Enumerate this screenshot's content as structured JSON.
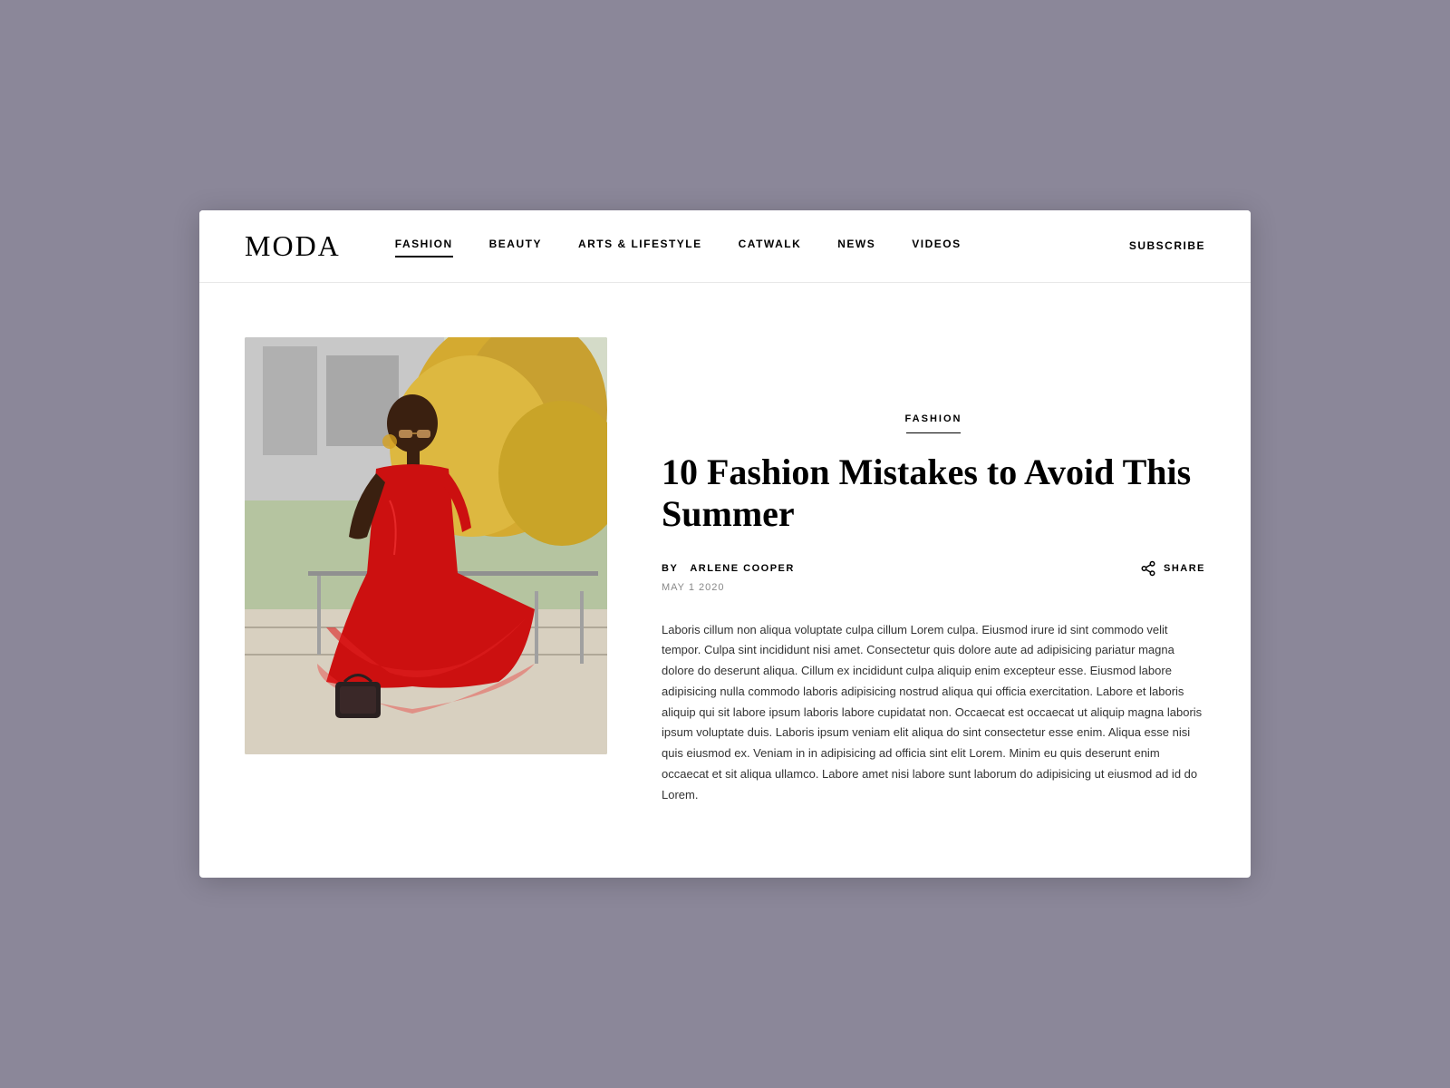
{
  "site": {
    "logo": "MODA",
    "nav": {
      "items": [
        {
          "label": "FASHION",
          "active": true
        },
        {
          "label": "BEAUTY",
          "active": false
        },
        {
          "label": "ARTS & LIFESTYLE",
          "active": false
        },
        {
          "label": "CATWALK",
          "active": false
        },
        {
          "label": "NEWS",
          "active": false
        },
        {
          "label": "VIDEOS",
          "active": false
        }
      ],
      "subscribe_label": "SUBSCRIBE"
    }
  },
  "article": {
    "category": "FASHION",
    "title": "10 Fashion Mistakes to Avoid This Summer",
    "author_prefix": "BY",
    "author": "ARLENE COOPER",
    "date": "MAY 1 2020",
    "share_label": "SHARE",
    "body": "Laboris cillum non aliqua voluptate culpa cillum Lorem culpa. Eiusmod irure id sint commodo velit tempor. Culpa sint incididunt nisi amet. Consectetur quis dolore aute ad adipisicing pariatur magna dolore do deserunt aliqua. Cillum ex incididunt culpa aliquip enim excepteur esse. Eiusmod labore adipisicing nulla commodo laboris adipisicing nostrud aliqua qui officia exercitation. Labore et laboris aliquip qui sit labore ipsum laboris labore cupidatat non. Occaecat est occaecat ut aliquip magna laboris ipsum voluptate duis. Laboris ipsum veniam elit aliqua do sint consectetur esse enim. Aliqua esse nisi quis eiusmod ex. Veniam in in adipisicing ad officia sint elit Lorem. Minim eu quis deserunt enim occaecat et sit aliqua ullamco. Labore amet nisi labore sunt laborum do adipisicing ut eiusmod ad id do Lorem."
  },
  "colors": {
    "background": "#8b8799",
    "white": "#ffffff",
    "black": "#000000",
    "text_body": "#333333",
    "text_muted": "#888888"
  }
}
